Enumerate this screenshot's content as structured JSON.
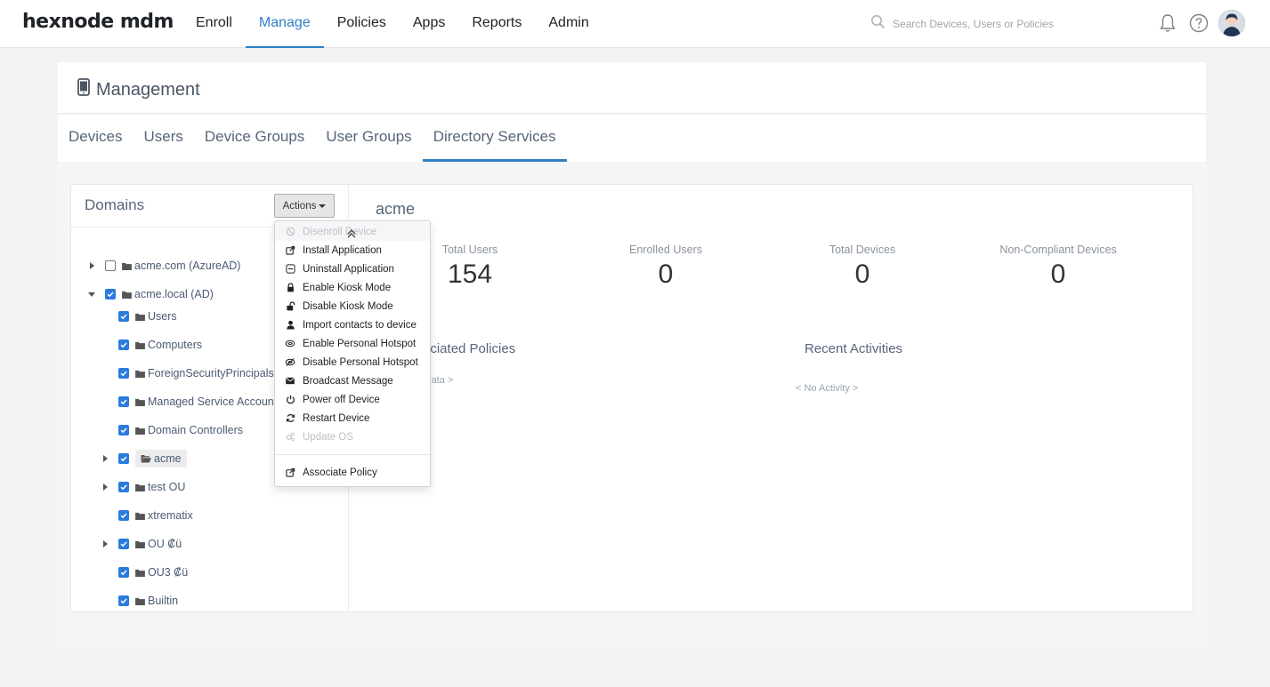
{
  "brand": {
    "logo": "hexnode mdm"
  },
  "nav": {
    "items": [
      {
        "label": "Enroll",
        "active": false
      },
      {
        "label": "Manage",
        "active": true
      },
      {
        "label": "Policies",
        "active": false
      },
      {
        "label": "Apps",
        "active": false
      },
      {
        "label": "Reports",
        "active": false
      },
      {
        "label": "Admin",
        "active": false
      }
    ],
    "search_placeholder": "Search Devices, Users or Policies"
  },
  "page": {
    "title": "Management",
    "tabs": [
      {
        "label": "Devices",
        "active": false
      },
      {
        "label": "Users",
        "active": false
      },
      {
        "label": "Device Groups",
        "active": false
      },
      {
        "label": "User Groups",
        "active": false
      },
      {
        "label": "Directory Services",
        "active": true
      }
    ]
  },
  "domains": {
    "title": "Domains",
    "actions_label": "Actions",
    "tree": [
      {
        "label": "acme.com (AzureAD)",
        "checked": false,
        "toggle": "collapsed"
      },
      {
        "label": "acme.local (AD)",
        "checked": true,
        "toggle": "expanded"
      },
      {
        "label": "Users",
        "checked": true,
        "toggle": "none"
      },
      {
        "label": "Computers",
        "checked": true,
        "toggle": "none"
      },
      {
        "label": "ForeignSecurityPrincipals",
        "checked": true,
        "toggle": "none"
      },
      {
        "label": "Managed Service Accounts",
        "checked": true,
        "toggle": "none"
      },
      {
        "label": "Domain Controllers",
        "checked": true,
        "toggle": "none"
      },
      {
        "label": "acme",
        "checked": true,
        "toggle": "collapsed",
        "selected": true
      },
      {
        "label": "test OU",
        "checked": true,
        "toggle": "collapsed"
      },
      {
        "label": "xtrematix",
        "checked": true,
        "toggle": "none"
      },
      {
        "label": "OU ₡ü",
        "checked": true,
        "toggle": "collapsed"
      },
      {
        "label": "OU3 ₡ü",
        "checked": true,
        "toggle": "none"
      },
      {
        "label": "Builtin",
        "checked": true,
        "toggle": "none"
      }
    ]
  },
  "actions_menu": {
    "items": [
      {
        "label": "Disenroll Device",
        "icon": "disenroll-icon",
        "disabled": true
      },
      {
        "label": "Install Application",
        "icon": "install-icon",
        "disabled": false
      },
      {
        "label": "Uninstall Application",
        "icon": "uninstall-icon",
        "disabled": false
      },
      {
        "label": "Enable Kiosk Mode",
        "icon": "lock-icon",
        "disabled": false
      },
      {
        "label": "Disable Kiosk Mode",
        "icon": "unlock-icon",
        "disabled": false
      },
      {
        "label": "Import contacts to device",
        "icon": "user-icon",
        "disabled": false
      },
      {
        "label": "Enable Personal Hotspot",
        "icon": "hotspot-icon",
        "disabled": false
      },
      {
        "label": "Disable Personal Hotspot",
        "icon": "hotspot-off-icon",
        "disabled": false
      },
      {
        "label": "Broadcast Message",
        "icon": "envelope-icon",
        "disabled": false
      },
      {
        "label": "Power off Device",
        "icon": "power-icon",
        "disabled": false
      },
      {
        "label": "Restart Device",
        "icon": "refresh-icon",
        "disabled": false
      },
      {
        "label": "Update OS",
        "icon": "gears-icon",
        "disabled": true
      }
    ],
    "footer_item": {
      "label": "Associate Policy",
      "icon": "share-icon"
    }
  },
  "detail": {
    "domain_name": "acme",
    "stats": [
      {
        "label": "Total Users",
        "value": "154"
      },
      {
        "label": "Enrolled Users",
        "value": "0"
      },
      {
        "label": "Total Devices",
        "value": "0"
      },
      {
        "label": "Non-Compliant Devices",
        "value": "0"
      }
    ],
    "associated_policies": {
      "title": "Associated Policies",
      "empty": "< No Data >"
    },
    "recent_activities": {
      "title": "Recent Activities",
      "empty": "< No Activity >"
    }
  },
  "colors": {
    "accent": "#2d7fc8",
    "checkbox": "#2b7bdc",
    "text_muted": "#56657a"
  }
}
